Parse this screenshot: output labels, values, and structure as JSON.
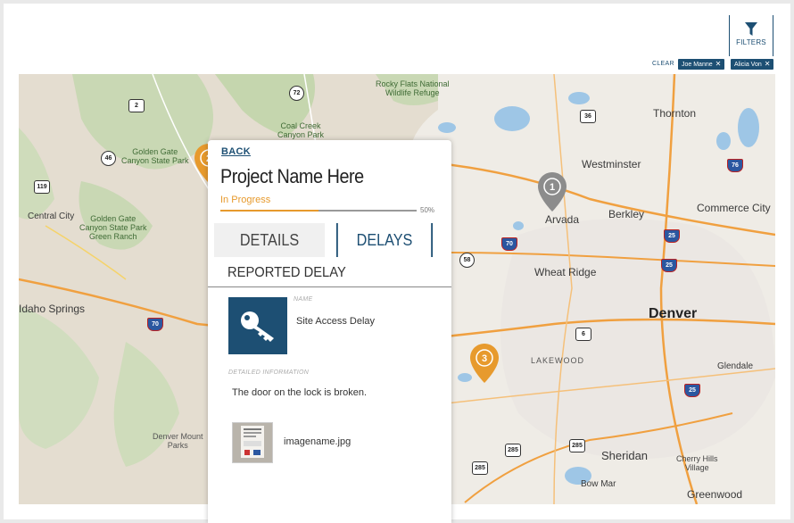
{
  "filters": {
    "button_label": "FILTERS",
    "clear_label": "CLEAR",
    "chips": [
      {
        "label": "Joe Manne"
      },
      {
        "label": "Alicia Von"
      }
    ]
  },
  "map": {
    "places": {
      "rocky_flats": "Rocky Flats National\nWildlife Refuge",
      "coal_creek": "Coal Creek\nCanyon Park",
      "golden_gate_1": "Golden Gate\nCanyon State Park",
      "golden_gate_2": "Golden Gate\nCanyon State Park\nGreen Ranch",
      "central_city": "Central City",
      "idaho_springs": "Idaho Springs",
      "denver_mountain_parks": "Denver Mount\nParks",
      "thornton": "Thornton",
      "westminster": "Westminster",
      "arvada": "Arvada",
      "berkley": "Berkley",
      "commerce_city": "Commerce City",
      "wheat_ridge": "Wheat Ridge",
      "denver": "Denver",
      "lakewood": "LAKEWOOD",
      "glendale": "Glendale",
      "sheridan": "Sheridan",
      "cherry_hills": "Cherry Hills\nVillage",
      "bow_mar": "Bow Mar",
      "greenwood": "Greenwood"
    },
    "routes": [
      "2",
      "72",
      "36",
      "46",
      "119",
      "76",
      "70",
      "25",
      "58",
      "6",
      "285"
    ],
    "pins": [
      {
        "number": "1",
        "color": "#8c8c8c"
      },
      {
        "number": "2",
        "color": "#e79a2d"
      },
      {
        "number": "3",
        "color": "#e79a2d"
      }
    ]
  },
  "panel": {
    "back_label": "BACK",
    "title": "Project Name Here",
    "status": "In Progress",
    "progress_percent": 50,
    "progress_label": "50%",
    "tabs": [
      {
        "label": "DETAILS",
        "active": false
      },
      {
        "label": "DELAYS",
        "active": true
      }
    ],
    "section_title": "REPORTED DELAY",
    "name_label": "NAME",
    "name_value": "Site Access Delay",
    "info_label": "DETAILED INFORMATION",
    "info_value": "The door on the lock is broken.",
    "attachment_name": "imagename.jpg",
    "delay_icon": "key-icon"
  },
  "colors": {
    "brand": "#1d4f73",
    "accent": "#e79a2d",
    "pin_inactive": "#8c8c8c"
  }
}
